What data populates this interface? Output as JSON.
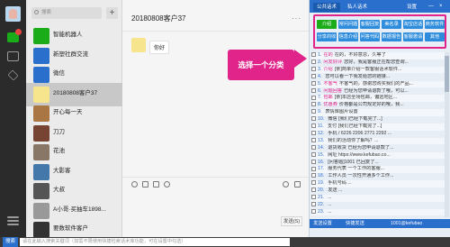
{
  "search": {
    "placeholder": "搜索"
  },
  "chats": [
    {
      "name": "智能机器人",
      "time": "",
      "sub": "",
      "color": "#1aad19"
    },
    {
      "name": "新塑社群交流",
      "time": "",
      "sub": "",
      "color": "#2b6fcc"
    },
    {
      "name": "微信",
      "time": "",
      "sub": "",
      "color": "#2b6fcc"
    },
    {
      "name": "20180808客户37",
      "time": "",
      "sub": "",
      "color": "#f6e58d"
    },
    {
      "name": "开心每一天",
      "time": "",
      "sub": "",
      "color": "#aa7744"
    },
    {
      "name": "刀刀",
      "time": "",
      "sub": "",
      "color": "#774433"
    },
    {
      "name": "花池",
      "time": "",
      "sub": "",
      "color": "#887766"
    },
    {
      "name": "大影客",
      "time": "",
      "sub": "",
      "color": "#4477aa"
    },
    {
      "name": "大叔",
      "time": "",
      "sub": "",
      "color": "#555"
    },
    {
      "name": "A小哥·买抽车1898...",
      "time": "",
      "sub": "",
      "color": "#999"
    },
    {
      "name": "要数软件客户",
      "time": "",
      "sub": "",
      "color": "#333"
    }
  ],
  "conversation": {
    "title": "20180808客户37",
    "more": "···",
    "message": "你好",
    "send_label": "发送(S)"
  },
  "panel": {
    "tabs": [
      "公共话术",
      "私人话术",
      "设置"
    ],
    "categories": [
      "介绍",
      "常问问题",
      "客服回复",
      "美名录",
      "淘宝店话",
      "商务软件",
      "分享的收",
      "信息介绍",
      "问答代码",
      "数据报告",
      "客服邀请",
      "其他"
    ],
    "rows": [
      {
        "num": "1.",
        "kw": "在的",
        "text": "在的，不好意思，久等了"
      },
      {
        "num": "2.",
        "kw": "问发好评",
        "text": "您好，我是客服正在帮您查询..."
      },
      {
        "num": "3.",
        "kw": "介绍",
        "text": "[亲]简单介绍一款客服话术软件..."
      },
      {
        "num": "4.",
        "kw": "",
        "text": "您可以看一下我发给您的链接..."
      },
      {
        "num": "5.",
        "kw": "不客气",
        "text": "不客气的，感谢您购买我们的产品..."
      },
      {
        "num": "6.",
        "kw": "问题回答",
        "text": "已经为您申请退款了哦，可以..."
      },
      {
        "num": "7.",
        "kw": "包邮",
        "text": "[亲]本店全场包邮，偏远地区..."
      },
      {
        "num": "8.",
        "kw": "优惠券",
        "text": "价格都是公司规定好的哦，我..."
      },
      {
        "num": "9.",
        "kw": "",
        "text": "表情库图片设置"
      },
      {
        "num": "10.",
        "kw": "",
        "text": "微信 [我们已经下载完了...]"
      },
      {
        "num": "11.",
        "kw": "",
        "text": "支付 [我们已经下载完了...]"
      },
      {
        "num": "12.",
        "kw": "",
        "text": "手机 / 6226 2206 2771 2292 ..."
      },
      {
        "num": "13.",
        "kw": "",
        "text": "我们的活动你了解吗？..."
      },
      {
        "num": "14.",
        "kw": "",
        "text": "退货收货 已经为您申请退款了..."
      },
      {
        "num": "15.",
        "kw": "",
        "text": "网址 https://www.kefubao.co..."
      },
      {
        "num": "16.",
        "kw": "",
        "text": "[问答题]1001 已回复了..."
      },
      {
        "num": "17.",
        "kw": "",
        "text": "服务代表 一个工作的客服..."
      },
      {
        "num": "18.",
        "kw": "",
        "text": "工作人员 一次性开通多个工作..."
      },
      {
        "num": "19.",
        "kw": "",
        "text": "手机号码 ..."
      },
      {
        "num": "20.",
        "kw": "",
        "text": "发送 ..."
      },
      {
        "num": "21.",
        "kw": "",
        "text": "..."
      },
      {
        "num": "22.",
        "kw": "",
        "text": "..."
      },
      {
        "num": "23.",
        "kw": "",
        "text": "..."
      }
    ],
    "bottom_left": "发送设置",
    "bottom_mid": "快捷发送",
    "bottom_right": "1001@kefubao"
  },
  "callout": {
    "text": "选择一个分类"
  },
  "bottom_bar": {
    "label": "搜索",
    "placeholder": "请在此输入搜索关键词（如需不限使用快捷检索话术库功能，可在设置中勾选）"
  }
}
